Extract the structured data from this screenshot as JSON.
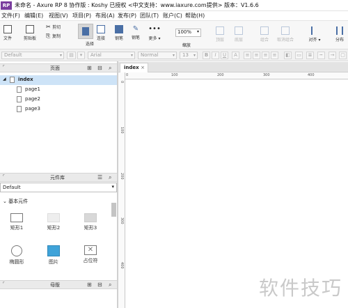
{
  "titlebar": {
    "logo": "RP",
    "title": "未命名 - Axure RP 8 协作版 : Koshy 已授权    <中文支持：www.iaxure.com提供> 版本：V1.6.6"
  },
  "menu": [
    "文件(F)",
    "编辑(E)",
    "视图(V)",
    "项目(P)",
    "布局(A)",
    "发布(P)",
    "团队(T)",
    "账户(C)",
    "帮助(H)"
  ],
  "toolbar": {
    "file": "文件",
    "clipboard": "剪贴板",
    "cut": "剪切",
    "paste_fmt": "复制",
    "select": "选择",
    "connect": "连接",
    "pen": "钢笔",
    "more": "更多 ▾",
    "zoom_value": "100%",
    "zoom_label": "缩放",
    "top": "顶层",
    "bottom": "底层",
    "group": "组合",
    "ungroup": "取消组合",
    "align": "对齐 ▾",
    "distribute": "分布"
  },
  "formatbar": {
    "style": "Default",
    "font": "Arial",
    "weight": "Normal",
    "size": "13",
    "bold": "B",
    "italic": "I",
    "underline": "U"
  },
  "pages_panel": {
    "title": "页面",
    "root": "index",
    "pages": [
      "page1",
      "page2",
      "page3"
    ]
  },
  "library_panel": {
    "title": "元件库",
    "library": "Default",
    "section": "基本元件",
    "widgets": [
      "矩形1",
      "矩形2",
      "矩形3",
      "椭圆形",
      "图片",
      "占位符"
    ]
  },
  "masters_panel": {
    "title": "母版"
  },
  "canvas": {
    "tab": "index",
    "h_ruler": [
      "0",
      "100",
      "200",
      "300",
      "400"
    ],
    "v_ruler": [
      "0",
      "100",
      "200",
      "300",
      "400"
    ]
  },
  "watermark": "软件技巧"
}
